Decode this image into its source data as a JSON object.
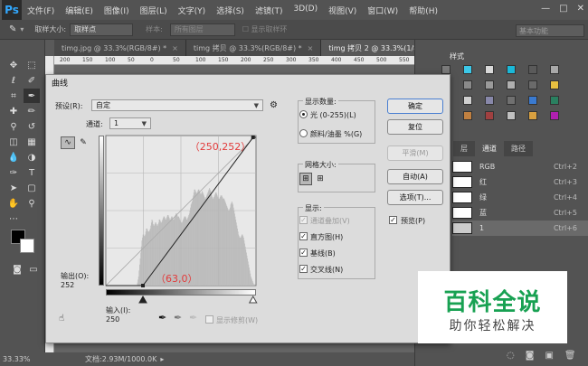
{
  "app": {
    "logo": "Ps",
    "menu": [
      "文件(F)",
      "编辑(E)",
      "图像(I)",
      "图层(L)",
      "文字(Y)",
      "选择(S)",
      "滤镜(T)",
      "3D(D)",
      "视图(V)",
      "窗口(W)",
      "帮助(H)"
    ],
    "window_controls": [
      "—",
      "□",
      "✕"
    ]
  },
  "options_bar": {
    "sample_size_label": "取样大小:",
    "sample_size_value": "取样点",
    "sample_label": "样本:",
    "sample_value": "所有图层",
    "show_ring": "显示取样环",
    "workspace": "基本功能"
  },
  "tabs": [
    {
      "label": "timg.jpg @ 33.3%(RGB/8#) *",
      "active": false
    },
    {
      "label": "timg 拷贝 @ 33.3%(RGB/8#) *",
      "active": false
    },
    {
      "label": "timg 拷贝 2 @ 33.3%(1/8) *",
      "active": true
    }
  ],
  "rulers": {
    "h": [
      "200",
      "150",
      "100",
      "50",
      "0",
      "50",
      "100",
      "150",
      "200",
      "250",
      "300",
      "350",
      "400",
      "450",
      "500",
      "550"
    ]
  },
  "status": {
    "zoom": "33.33%",
    "doc": "文档:2.93M/1000.0K"
  },
  "panels": {
    "swatches_tab": "样式",
    "channels_tabs": [
      "层",
      "通道",
      "路径"
    ],
    "channels": [
      {
        "name": "RGB",
        "key": "Ctrl+2",
        "selected": false,
        "thumb": "#ffffff"
      },
      {
        "name": "红",
        "key": "Ctrl+3",
        "selected": false,
        "thumb": "#ffffff"
      },
      {
        "name": "绿",
        "key": "Ctrl+4",
        "selected": false,
        "thumb": "#ffffff"
      },
      {
        "name": "蓝",
        "key": "Ctrl+5",
        "selected": false,
        "thumb": "#ffffff"
      },
      {
        "name": "1",
        "key": "Ctrl+6",
        "selected": true,
        "thumb": "#cccccc"
      }
    ]
  },
  "curves": {
    "title": "曲线",
    "preset_label": "预设(R):",
    "preset_value": "自定",
    "channel_label": "通道:",
    "channel_value": "1",
    "output_label": "输出(O):",
    "output_value": "252",
    "input_label": "输入(I):",
    "input_value": "250",
    "point_top_label": "（250,252）",
    "point_bottom_label": "（63,0）",
    "show_clipping": "显示修剪(W)",
    "show_amount_title": "显示数量:",
    "light_option": "光 (0-255)(L)",
    "pigment_option": "颜料/油墨 %(G)",
    "grid_size_title": "网格大小:",
    "display_title": "显示:",
    "display_options": [
      {
        "label": "通道叠加(V)",
        "checked": true,
        "disabled": true
      },
      {
        "label": "直方图(H)",
        "checked": true,
        "disabled": false
      },
      {
        "label": "基线(B)",
        "checked": true,
        "disabled": false
      },
      {
        "label": "交叉线(N)",
        "checked": true,
        "disabled": false
      }
    ],
    "buttons": {
      "ok": "确定",
      "reset": "复位",
      "smooth": "平滑(M)",
      "auto": "自动(A)",
      "options": "选项(T)..."
    },
    "preview_label": "预览(P)",
    "curve_points": [
      [
        63,
        0
      ],
      [
        250,
        252
      ]
    ],
    "histogram": [
      0,
      0,
      0,
      0,
      0,
      0,
      0,
      0,
      0,
      0,
      0,
      0,
      0,
      0,
      0,
      0,
      0,
      0,
      0,
      0,
      0,
      0,
      0,
      0,
      0,
      0,
      0,
      0,
      0,
      0,
      0,
      0,
      0,
      0,
      0,
      0,
      0,
      0,
      0,
      0,
      0,
      0,
      0,
      0,
      0,
      0,
      0,
      0,
      0,
      0,
      0,
      0,
      0,
      0,
      0,
      0,
      2,
      4,
      6,
      10,
      14,
      18,
      22,
      26,
      30,
      32,
      34,
      34,
      33,
      33,
      34,
      36,
      38,
      38,
      37,
      36,
      36,
      36,
      37,
      38,
      40,
      42,
      44,
      43,
      41,
      40,
      40,
      41,
      42,
      42,
      41,
      40,
      40,
      41,
      42,
      44,
      44,
      43,
      42,
      42,
      43,
      44,
      45,
      46,
      46,
      45,
      44,
      44,
      45,
      46,
      47,
      47,
      46,
      45,
      44,
      44,
      45,
      46,
      46,
      45,
      44,
      44,
      45,
      46,
      47,
      48,
      48,
      47,
      46,
      46,
      46,
      45,
      44,
      43,
      42,
      42,
      42,
      43,
      44,
      45,
      46,
      46,
      46,
      45,
      44,
      44,
      45,
      46,
      47,
      48,
      50,
      52,
      54,
      55,
      56,
      58,
      60,
      62,
      64,
      64,
      63,
      62,
      61,
      62,
      63,
      64,
      64,
      63,
      62,
      61,
      61,
      62,
      63,
      62,
      61,
      60,
      59,
      58,
      58,
      59,
      60,
      61,
      62,
      63,
      64,
      65,
      64,
      63,
      62,
      60,
      59,
      58,
      58,
      59,
      60,
      61,
      62,
      62,
      61,
      60,
      59,
      58,
      58,
      58,
      59,
      60,
      60,
      60,
      59,
      58,
      58,
      58,
      57,
      56,
      55,
      54,
      53,
      52,
      51,
      50,
      50,
      51,
      52,
      54,
      55,
      56,
      55,
      54,
      52,
      50,
      48,
      46,
      44,
      42,
      40,
      38,
      36,
      34,
      33,
      32,
      32,
      32,
      33,
      34,
      34,
      33,
      32,
      30,
      28,
      26,
      24,
      22,
      20,
      18,
      16,
      14,
      12,
      10,
      8,
      6,
      5,
      4,
      3,
      2,
      1,
      1,
      0,
      0,
      0
    ]
  },
  "watermark": {
    "title": "百科全说",
    "subtitle": "助你轻松解决"
  }
}
